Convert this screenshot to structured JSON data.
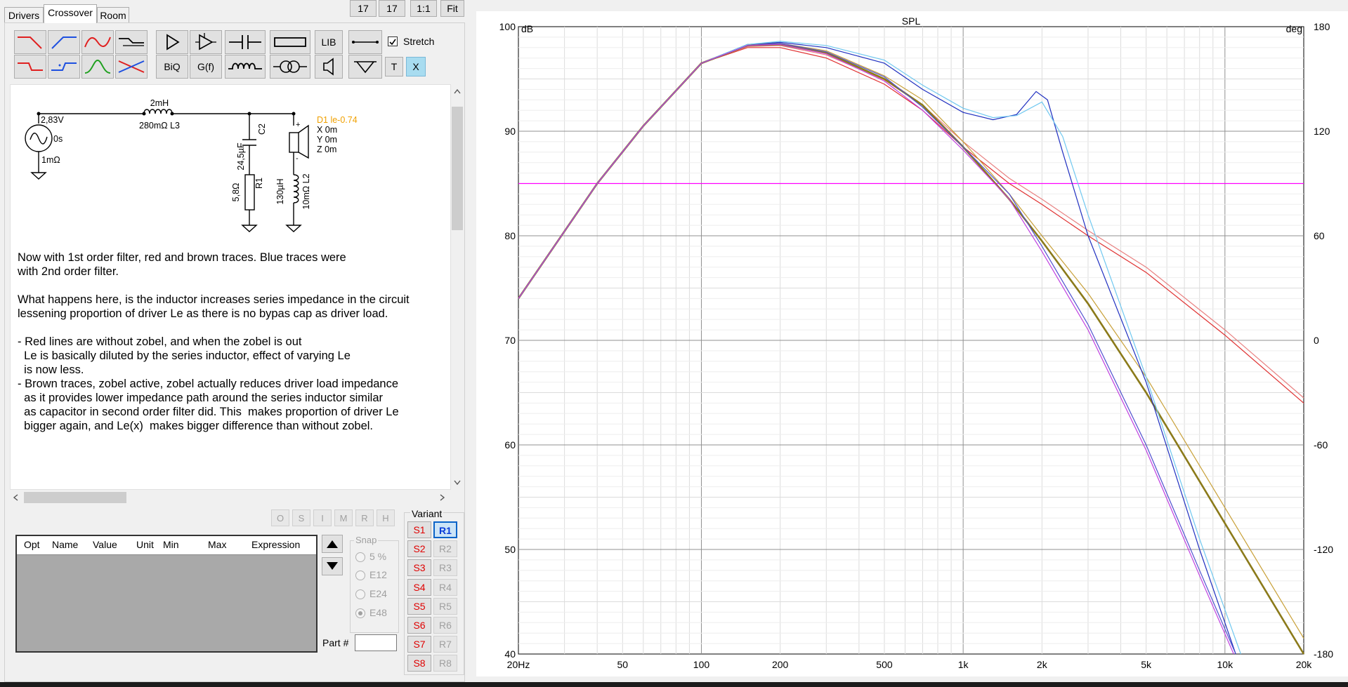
{
  "top_buttons": [
    "17",
    "17",
    "1:1",
    "Fit"
  ],
  "tabs": [
    {
      "label": "Drivers"
    },
    {
      "label": "Crossover"
    },
    {
      "label": "Room"
    }
  ],
  "toolbar": {
    "lib_label": "LIB",
    "biq_label": "BiQ",
    "gf_label": "G(f)",
    "t_label": "T",
    "x_label": "X",
    "stretch_label": "Stretch",
    "stretch_checked": true
  },
  "schematic": {
    "source_voltage": "2,83V",
    "source_delay": "0s",
    "source_resistance": "1mΩ",
    "l3_value": "2mH",
    "l3_label": "280mΩ L3",
    "c2_value": "24,5µF",
    "c2_name": "C2",
    "r1_value": "5,8Ω",
    "r1_name": "R1",
    "l2_value": "130µH",
    "l2_label": "10mΩ L2",
    "driver_label": "D1 le-0.74",
    "driver_x": "X 0m",
    "driver_y": "Y 0m",
    "driver_z": "Z 0m"
  },
  "notes": "Now with 1st order filter, red and brown traces. Blue traces were\nwith 2nd order filter.\n\nWhat happens here, is the inductor increases series impedance in the circuit\nlessening proportion of driver Le as there is no bypas cap as driver load.\n\n- Red lines are without zobel, and when the zobel is out\n  Le is basically diluted by the series inductor, effect of varying Le\n  is now less.\n- Brown traces, zobel active, zobel actually reduces driver load impedance\n  as it provides lower impedance path around the series inductor similar\n  as capacitor in second order filter did. This  makes proportion of driver Le\n  bigger again, and Le(x)  makes bigger difference than without zobel.",
  "flag_buttons": [
    "O",
    "S",
    "I",
    "M",
    "R",
    "H"
  ],
  "table": {
    "columns": [
      "Opt",
      "Name",
      "Value",
      "Unit",
      "Min",
      "Max",
      "Expression"
    ]
  },
  "snap": {
    "label": "Snap",
    "options": [
      "5 %",
      "E12",
      "E24",
      "E48"
    ],
    "selected": "E48"
  },
  "part_label": "Part #",
  "variant": {
    "label": "Variant",
    "s_buttons": [
      "S1",
      "S2",
      "S3",
      "S4",
      "S5",
      "S6",
      "S7",
      "S8"
    ],
    "r_buttons": [
      "R1",
      "R2",
      "R3",
      "R4",
      "R5",
      "R6",
      "R7",
      "R8"
    ],
    "selected": "R1"
  },
  "chart_data": {
    "type": "line",
    "title": "SPL",
    "ylabel": "dB",
    "y2label": "deg",
    "xscale": "log",
    "xlim": [
      20,
      20000
    ],
    "ylim": [
      40,
      100
    ],
    "y2lim": [
      -180,
      180
    ],
    "x_ticks": [
      "20Hz",
      "50",
      "100",
      "200",
      "500",
      "1k",
      "2k",
      "5k",
      "10k",
      "20k"
    ],
    "x_tick_values": [
      20,
      50,
      100,
      200,
      500,
      1000,
      2000,
      5000,
      10000,
      20000
    ],
    "y_ticks": [
      100,
      90,
      80,
      70,
      60,
      50,
      40
    ],
    "y2_ticks": [
      180,
      120,
      60,
      0,
      -60,
      -120,
      -180
    ],
    "grid": true,
    "series": [
      {
        "color": "#ff00ff",
        "x": [
          20,
          20000
        ],
        "y": [
          85,
          85
        ]
      },
      {
        "color": "#e03030",
        "x": [
          20,
          40,
          60,
          100,
          150,
          200,
          300,
          500,
          700,
          1000,
          1500,
          2000,
          3000,
          5000,
          10000,
          20000
        ],
        "y": [
          74,
          85,
          90.5,
          96.5,
          98,
          98,
          97,
          94.5,
          92,
          88.5,
          85,
          83,
          80,
          76.5,
          70.5,
          64
        ]
      },
      {
        "color": "#e88080",
        "x": [
          20,
          40,
          60,
          100,
          150,
          200,
          300,
          500,
          700,
          1000,
          1500,
          2000,
          3000,
          5000,
          10000,
          20000
        ],
        "y": [
          74,
          85,
          90.5,
          96.5,
          98.1,
          98.2,
          97.3,
          94.9,
          92.5,
          89,
          85.5,
          83.5,
          80.5,
          77,
          71,
          64.5
        ]
      },
      {
        "color": "#8b7a1a",
        "x": [
          20,
          40,
          60,
          100,
          150,
          200,
          300,
          500,
          700,
          1000,
          1500,
          2000,
          3000,
          5000,
          10000,
          20000
        ],
        "y": [
          74,
          85,
          90.5,
          96.5,
          98.2,
          98.3,
          97.5,
          95,
          92.5,
          88.5,
          83.5,
          79.5,
          73.5,
          65,
          52.5,
          40
        ]
      },
      {
        "color": "#c8a038",
        "x": [
          20,
          40,
          60,
          100,
          150,
          200,
          300,
          500,
          700,
          1000,
          1500,
          2000,
          3000,
          5000,
          10000,
          20000
        ],
        "y": [
          74,
          85,
          90.5,
          96.5,
          98.3,
          98.4,
          97.7,
          95.3,
          93,
          89,
          84,
          80,
          74.5,
          66.5,
          54,
          41.5
        ]
      },
      {
        "color": "#2030c0",
        "x": [
          20,
          40,
          60,
          100,
          150,
          200,
          300,
          500,
          700,
          1000,
          1300,
          1600,
          1900,
          2100,
          2400,
          3000,
          5000,
          8000,
          11000
        ],
        "y": [
          74,
          85,
          90.5,
          96.5,
          98.3,
          98.5,
          98,
          96.5,
          94,
          91.8,
          91.1,
          91.6,
          93.8,
          93,
          88,
          80,
          66,
          50,
          40
        ]
      },
      {
        "color": "#70c8f0",
        "x": [
          20,
          40,
          60,
          100,
          150,
          200,
          300,
          500,
          700,
          1000,
          1300,
          1600,
          2000,
          2400,
          3000,
          5000,
          8000,
          11500
        ],
        "y": [
          74,
          85,
          90.5,
          96.5,
          98.3,
          98.6,
          98.2,
          96.8,
          94.4,
          92.2,
          91.3,
          91.5,
          92.8,
          89.5,
          82,
          66.5,
          51,
          40
        ]
      },
      {
        "color": "#5050d0",
        "x": [
          20,
          40,
          60,
          100,
          150,
          200,
          300,
          500,
          700,
          1000,
          1500,
          2000,
          3000,
          5000,
          8000,
          11000
        ],
        "y": [
          74,
          85,
          90.5,
          96.5,
          98.2,
          98.4,
          97.6,
          95.2,
          92.3,
          88.5,
          84,
          79,
          71.5,
          60,
          48,
          40
        ]
      },
      {
        "color": "#c040e0",
        "x": [
          20,
          40,
          60,
          100,
          150,
          200,
          300,
          500,
          700,
          1000,
          1500,
          2000,
          3000,
          5000,
          8000,
          10800
        ],
        "y": [
          74,
          85,
          90.5,
          96.5,
          98.2,
          98.3,
          97.4,
          94.8,
          92,
          88.2,
          83.5,
          78.5,
          71,
          59.5,
          47.5,
          40
        ]
      }
    ]
  }
}
